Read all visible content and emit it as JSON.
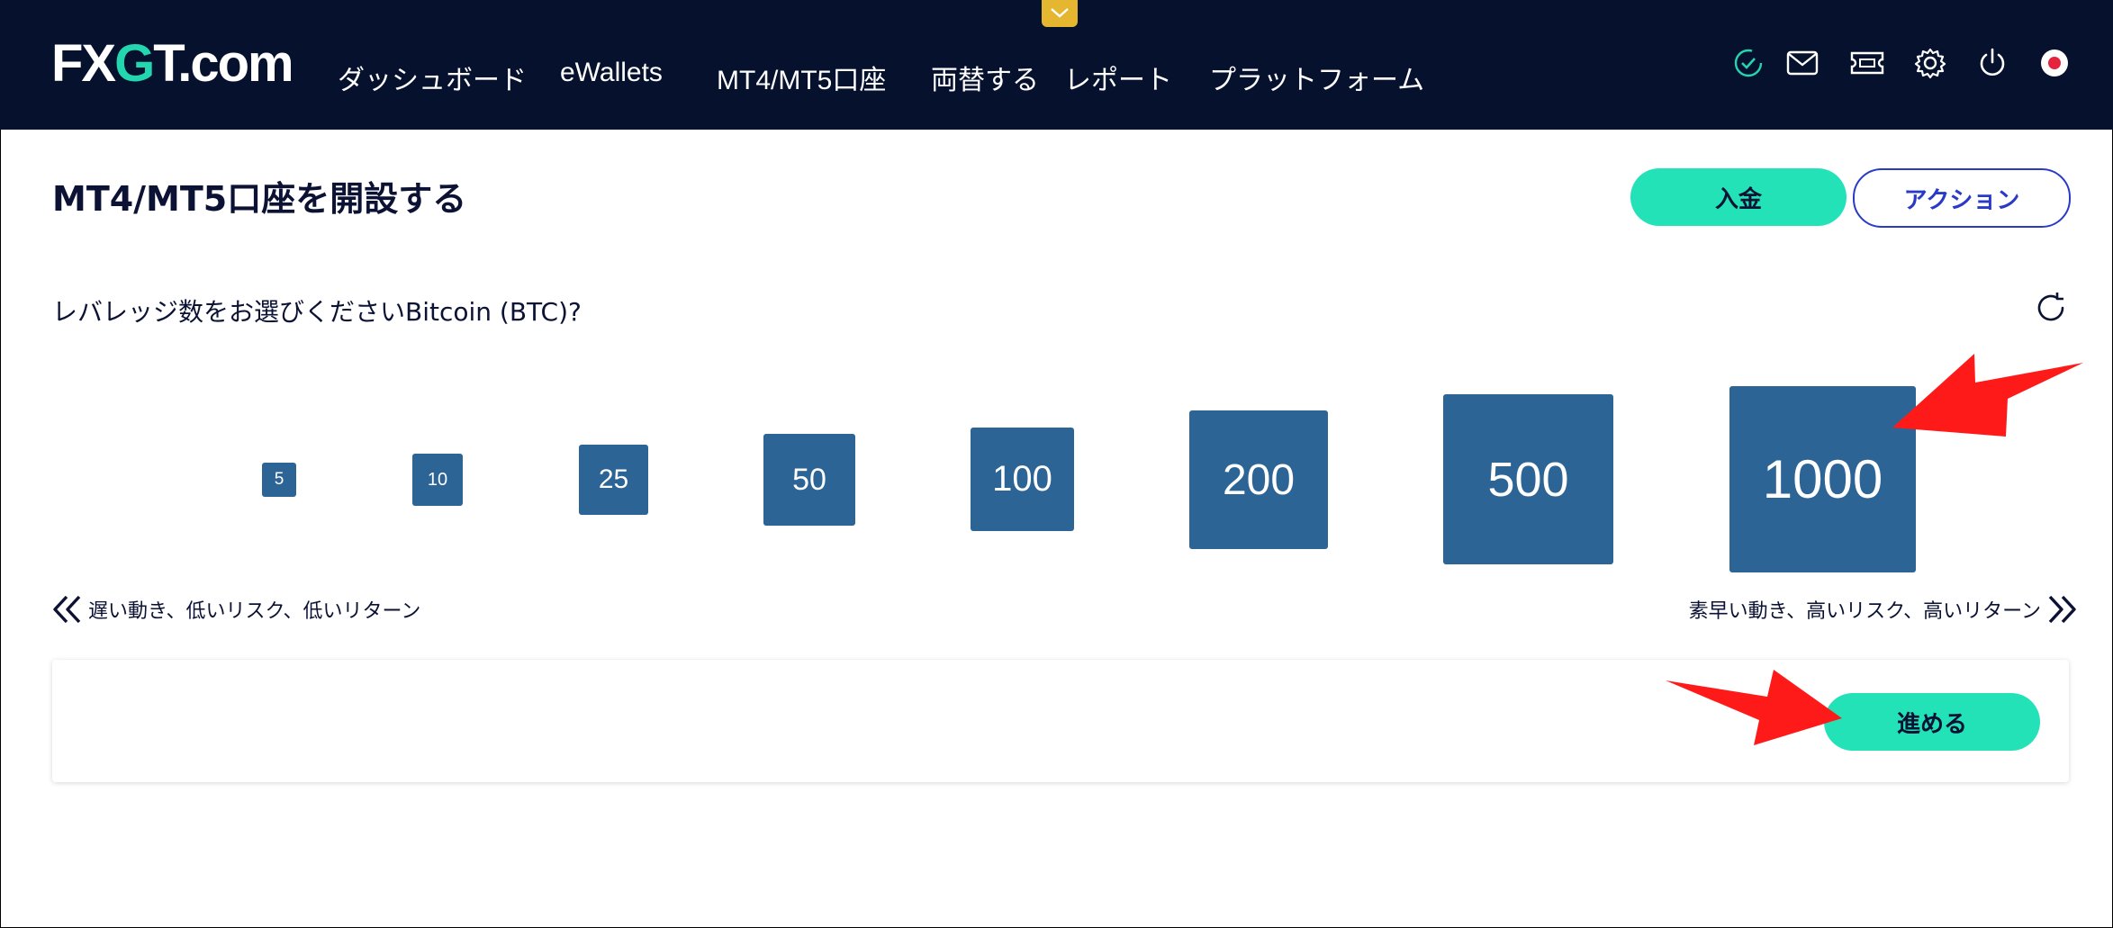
{
  "header": {
    "logo_text": "FXGT.com",
    "nav_items": [
      "ダッシュボード",
      "eWallets",
      "MT4/MT5口座",
      "両替する",
      "レポート",
      "プラットフォーム"
    ],
    "icons": [
      "verified-check-icon",
      "mail-icon",
      "ticket-icon",
      "gear-icon",
      "power-icon",
      "language-flag-icon"
    ]
  },
  "page": {
    "title": "MT4/MT5口座を開設する",
    "deposit_label": "入金",
    "action_label": "アクション",
    "question": "レバレッジ数をお選びくださいBitcoin (BTC)?"
  },
  "leverage": {
    "options": [
      "5",
      "10",
      "25",
      "50",
      "100",
      "200",
      "500",
      "1000"
    ],
    "selected": "1000",
    "left_hint": "遅い動き、低いリスク、低いリターン",
    "right_hint": "素早い動き、高いリスク、高いリターン"
  },
  "footer_panel": {
    "proceed_label": "進める"
  },
  "colors": {
    "nav_bg": "#06112e",
    "accent_green": "#23e2b8",
    "leverage_box": "#2d6496",
    "action_blue": "#2a3ac8",
    "annotation_red": "#ff1a1a"
  }
}
